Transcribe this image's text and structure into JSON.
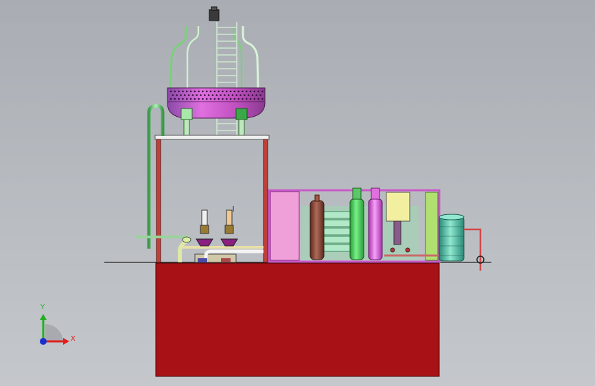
{
  "viewport": {
    "background_top": "#a9adb3",
    "background_bottom": "#c4c7cb"
  },
  "triad": {
    "x_label": "X",
    "y_label": "Y",
    "x_color": "#e02020",
    "y_color": "#20b020",
    "z_color": "#1830d0"
  },
  "model_colors": {
    "foundation": "#a81216",
    "tank_body": "#c84fc4",
    "frame": "#b8372e",
    "enclosure": "#c85ac8",
    "pink_panel": "#f0a0d8",
    "green_vessel": "#4cdc5a",
    "magenta_vessel": "#e060e0",
    "brown_cylinder": "#8a4a3a",
    "teal_tank": "#58c8a8",
    "yellow_box": "#f2f0a0",
    "lime_column": "#b0e070"
  }
}
